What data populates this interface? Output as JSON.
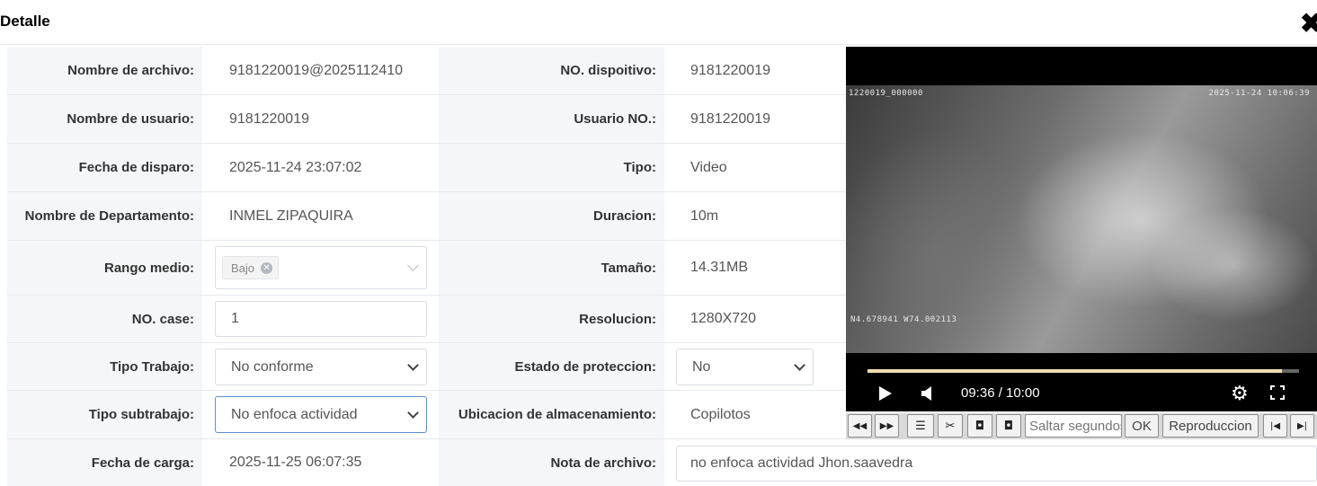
{
  "dialog": {
    "title": "Detalle",
    "close_glyph": "✖"
  },
  "rows": [
    {
      "left_label": "Nombre de archivo:",
      "left_value": "9181220019@2025112410",
      "right_label": "NO. dispoitivo:",
      "right_value": "9181220019"
    },
    {
      "left_label": "Nombre de usuario:",
      "left_value": "9181220019",
      "right_label": "Usuario NO.:",
      "right_value": "9181220019"
    },
    {
      "left_label": "Fecha de disparo:",
      "left_value": "2025-11-24 23:07:02",
      "right_label": "Tipo:",
      "right_value": "Video"
    },
    {
      "left_label": "Nombre de Departamento:",
      "left_value": "INMEL ZIPAQUIRA",
      "right_label": "Duracion:",
      "right_value": "10m"
    },
    {
      "left_label": "Rango medio:",
      "left_tag": "Bajo",
      "right_label": "Tamaño:",
      "right_value": "14.31MB"
    },
    {
      "left_label": "NO. case:",
      "left_input": "1",
      "right_label": "Resolucion:",
      "right_value": "1280X720"
    },
    {
      "left_label": "Tipo Trabajo:",
      "left_select": "No conforme",
      "right_label": "Estado de proteccion:",
      "right_select": "No"
    },
    {
      "left_label": "Tipo subtrabajo:",
      "left_select": "No enfoca actividad",
      "right_label": "Ubicacion de almacenamiento:",
      "right_value": "Copilotos"
    },
    {
      "left_label": "Fecha de carga:",
      "left_value": "2025-11-25 06:07:35",
      "right_label": "Nota de archivo:",
      "right_input": "no enfoca actividad Jhon.saavedra"
    }
  ],
  "player": {
    "osd_top_left": "1220019_000000",
    "osd_top_right": "2025-11-24 10:06:39",
    "osd_bottom_left": "N4.678941  W74.002113",
    "time": "09:36 / 10:00",
    "progress_fraction": 0.96,
    "progress_color": "#f0dcb0",
    "play_icon": "play-icon",
    "volume_icon": "volume-icon",
    "settings_icon": "gear-icon",
    "fullscreen_icon": "fullscreen-icon"
  },
  "toolbar": {
    "rewind": "◀◀",
    "forward": "▶▶",
    "list": "☰",
    "cut": "✂",
    "prev_frame": "◘",
    "next_frame": "◘",
    "seek_placeholder": "Saltar segundos",
    "ok_label": "OK",
    "playback_label": "Reproduccion",
    "skip_start": "|◀",
    "skip_end": "▶|"
  }
}
